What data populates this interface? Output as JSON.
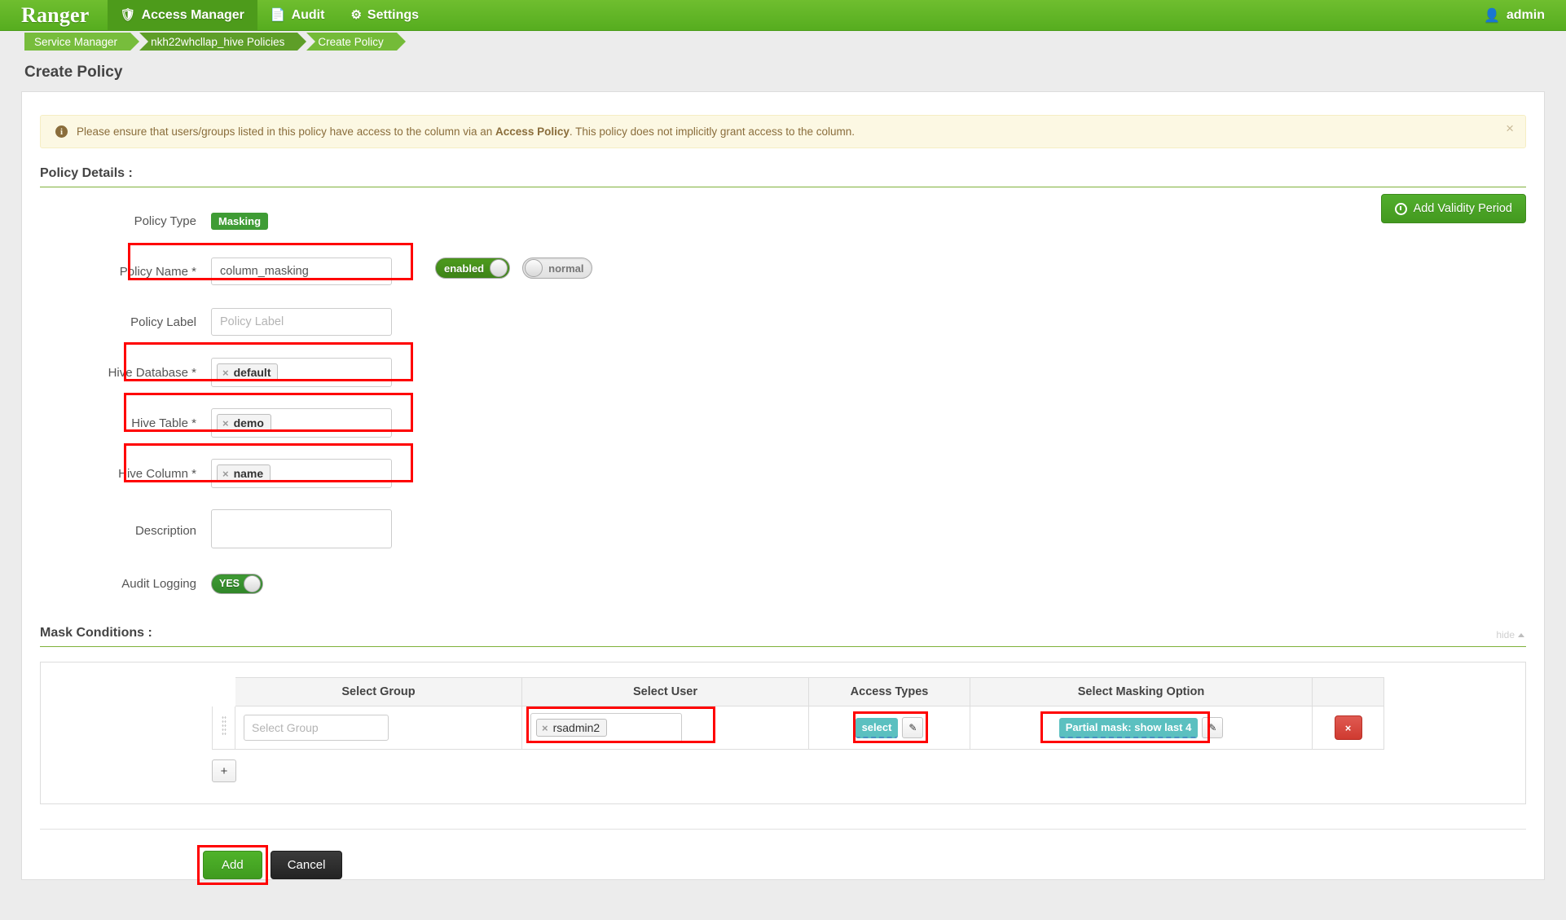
{
  "topnav": {
    "brand": "Ranger",
    "items": [
      {
        "label": "Access Manager",
        "icon": "shield-icon",
        "active": true
      },
      {
        "label": "Audit",
        "icon": "file-icon",
        "active": false
      },
      {
        "label": "Settings",
        "icon": "gear-icon",
        "active": false
      }
    ],
    "user": "admin",
    "user_icon": "user-icon"
  },
  "breadcrumb": {
    "items": [
      "Service Manager",
      "nkh22whcllap_hive Policies",
      "Create Policy"
    ]
  },
  "page_title": "Create Policy",
  "alert": {
    "icon": "info-icon",
    "text_before": "Please ensure that users/groups listed in this policy have access to the column via an ",
    "emphasis": "Access Policy",
    "text_after": ". This policy does not implicitly grant access to the column.",
    "close_label": "×"
  },
  "policy_details": {
    "section_title": "Policy Details :",
    "validity_button": "Add Validity Period",
    "fields": {
      "policy_type": {
        "label": "Policy Type",
        "value": "Masking"
      },
      "policy_name": {
        "label": "Policy Name *",
        "value": "column_masking"
      },
      "policy_label": {
        "label": "Policy Label",
        "value": "",
        "placeholder": "Policy Label"
      },
      "hive_database": {
        "label": "Hive Database *",
        "token": "default",
        "remove": "×"
      },
      "hive_table": {
        "label": "Hive Table *",
        "token": "demo",
        "remove": "×"
      },
      "hive_column": {
        "label": "Hive Column *",
        "token": "name",
        "remove": "×"
      },
      "description": {
        "label": "Description",
        "value": ""
      },
      "audit_logging": {
        "label": "Audit Logging",
        "value": "YES"
      }
    },
    "toggles": {
      "status": "enabled",
      "override": "normal"
    }
  },
  "mask_conditions": {
    "section_title": "Mask Conditions :",
    "hide_label": "hide",
    "columns": [
      "Select Group",
      "Select User",
      "Access Types",
      "Select Masking Option",
      ""
    ],
    "rows": [
      {
        "group_placeholder": "Select Group",
        "user_token": "rsadmin2",
        "user_remove": "×",
        "access_type": "select",
        "masking_option": "Partial mask: show last 4",
        "edit_icon": "pencil-icon",
        "delete_label": "×"
      }
    ],
    "add_row_label": "+"
  },
  "footer": {
    "add_label": "Add",
    "cancel_label": "Cancel"
  },
  "colors": {
    "brand_green": "#56ad1f",
    "accent_green": "#3f9c35",
    "chip_teal": "#5bc0c0",
    "alert_bg": "#fcf8e3",
    "alert_text": "#8a6d3b",
    "highlight_red": "#ff0000",
    "danger_red": "#cf3a30"
  }
}
